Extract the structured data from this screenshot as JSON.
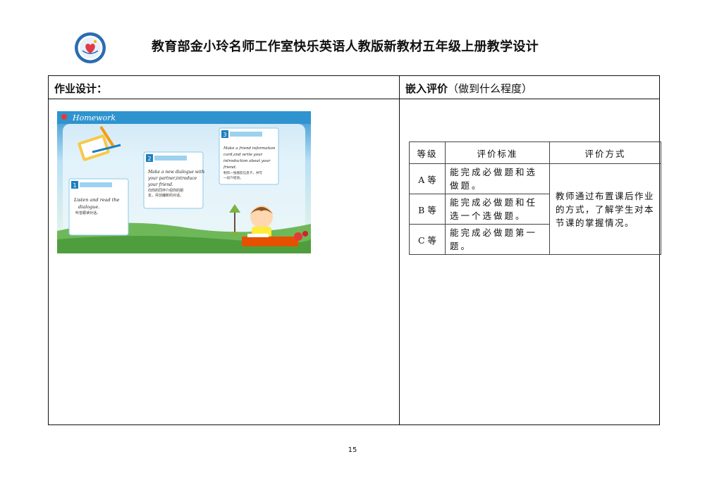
{
  "header": {
    "title": "教育部金小玲名师工作室快乐英语人教版新教材五年级上册教学设计",
    "logo_icon": "studio-seal-logo-icon"
  },
  "table": {
    "left_header": "作业设计：",
    "right_header_bold": "嵌入评价",
    "right_header_normal": "（做到什么程度）"
  },
  "slide": {
    "title": "Homework",
    "tasks": [
      {
        "num": "1",
        "english": [
          "Listen and read the",
          "dialogue."
        ],
        "chinese": [
          "听音跟读对话。"
        ]
      },
      {
        "num": "2",
        "english": [
          "Make a new dialogue with",
          "your partner,introduce",
          "your friend."
        ],
        "chinese": [
          "向你的同伴介绍你的朋",
          "友，并创编新的对话。"
        ]
      },
      {
        "num": "3",
        "english": [
          "Make a friend information",
          "card,and write your",
          "introduction about your",
          "friend."
        ],
        "chinese": [
          "制作一张朋友信息卡，并写",
          "一段介绍语。"
        ]
      }
    ]
  },
  "evaluation": {
    "headers": [
      "等级",
      "评价标准",
      "评价方式"
    ],
    "rows": [
      {
        "grade": "A 等",
        "standard": "能完成必做题和选做题。"
      },
      {
        "grade": "B 等",
        "standard": "能完成必做题和任选一个选做题。"
      },
      {
        "grade": "C 等",
        "standard": "能完成必做题第一题。"
      }
    ],
    "method": "教师通过布置课后作业的方式，了解学生对本节课的掌握情况。"
  },
  "page_number": "15",
  "colors": {
    "slide_top": "#2f93cf",
    "grass": "#6fb85a",
    "task_badge": "#1e7fbf"
  }
}
